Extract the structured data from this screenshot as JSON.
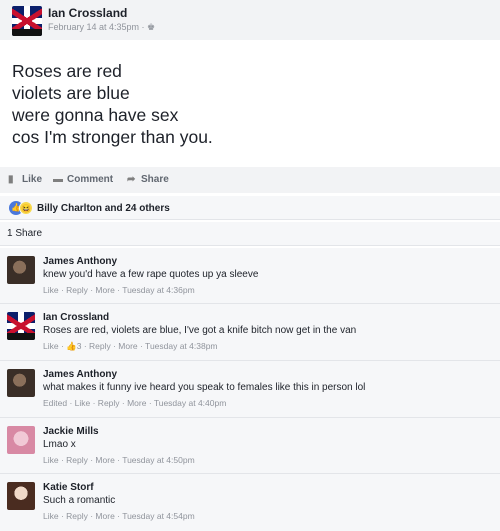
{
  "post": {
    "author": "Ian Crossland",
    "meta": "February 14 at 4:35pm · ♚",
    "lines": [
      "Roses are red",
      "violets are blue",
      "were gonna have sex",
      "cos I'm stronger than you."
    ]
  },
  "actions": {
    "like": "Like",
    "comment": "Comment",
    "share": "Share"
  },
  "reactions": {
    "like_icon": "👍",
    "haha_icon": "😆",
    "text": "Billy Charlton and 24 others"
  },
  "shares": "1 Share",
  "comments": [
    {
      "name": "James Anthony",
      "text": "knew you'd have a few rape quotes up ya sleeve",
      "meta": "Like · Reply · More · Tuesday at 4:36pm"
    },
    {
      "name": "Ian Crossland",
      "text": "Roses are red, violets are blue, I've got a knife bitch now get in the van",
      "meta": "Like · 👍3 · Reply · More · Tuesday at 4:38pm"
    },
    {
      "name": "James Anthony",
      "text": "what makes it funny ive heard you speak to females like this in person lol",
      "meta": "Edited · Like · Reply · More · Tuesday at 4:40pm"
    },
    {
      "name": "Jackie Mills",
      "text": "Lmao x",
      "meta": "Like · Reply · More · Tuesday at 4:50pm"
    },
    {
      "name": "Katie Storf",
      "text": "Such a romantic",
      "meta": "Like · Reply · More · Tuesday at 4:54pm"
    }
  ]
}
